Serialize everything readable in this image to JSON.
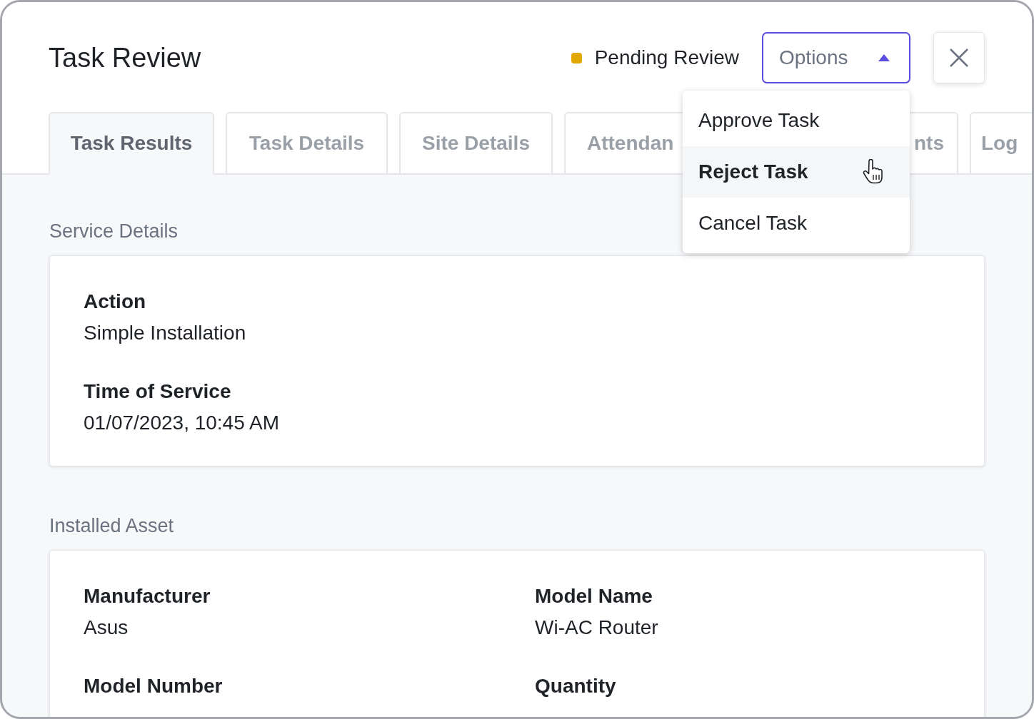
{
  "window": {
    "title": "Task Review"
  },
  "status": {
    "label": "Pending Review",
    "color": "#e0a800"
  },
  "options_button": {
    "label": "Options",
    "expanded": true
  },
  "dropdown": {
    "items": [
      {
        "label": "Approve Task",
        "selected": false
      },
      {
        "label": "Reject Task",
        "selected": true
      },
      {
        "label": "Cancel Task",
        "selected": false
      }
    ]
  },
  "tabs": [
    {
      "label": "Task Results",
      "selected": true
    },
    {
      "label": "Task Details",
      "selected": false
    },
    {
      "label": "Site Details",
      "selected": false
    },
    {
      "label": "Attendan",
      "selected": false
    },
    {
      "label": "nts",
      "selected": false
    },
    {
      "label": "Log",
      "selected": false
    }
  ],
  "sections": [
    {
      "title": "Service Details",
      "fields": [
        {
          "label": "Action",
          "value": "Simple Installation"
        },
        {
          "label": "Time of Service",
          "value": "01/07/2023, 10:45 AM"
        }
      ]
    },
    {
      "title": "Installed Asset",
      "fields": [
        {
          "label": "Manufacturer",
          "value": "Asus"
        },
        {
          "label": "Model Name",
          "value": "Wi-AC Router"
        },
        {
          "label": "Model Number"
        },
        {
          "label": "Quantity"
        }
      ]
    }
  ]
}
